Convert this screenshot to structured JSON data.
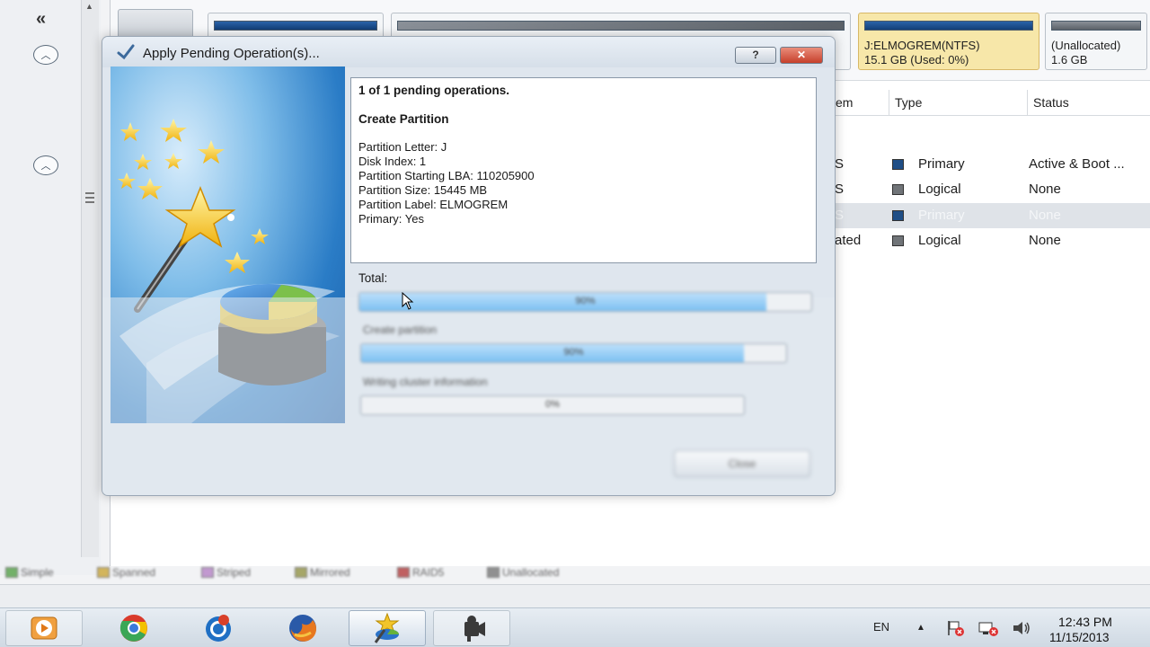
{
  "disk_map": {
    "partitions": [
      {
        "label": "",
        "detail": "",
        "bar": "blue"
      },
      {
        "label": "",
        "detail": "",
        "bar": "grey"
      },
      {
        "label": "J:ELMOGREM(NTFS)",
        "detail": "15.1 GB (Used: 0%)",
        "bar": "blue",
        "selected": true
      },
      {
        "label": "(Unallocated)",
        "detail": "1.6 GB",
        "bar": "grey"
      }
    ]
  },
  "partition_table": {
    "headers": {
      "file_system": "em",
      "type": "Type",
      "status": "Status"
    },
    "rows": [
      {
        "fs": "S",
        "type": "Primary",
        "type_color": "#1f4e86",
        "status": "Active & Boot ...",
        "selected": false
      },
      {
        "fs": "S",
        "type": "Logical",
        "type_color": "#707478",
        "status": "None",
        "selected": false
      },
      {
        "fs": "S",
        "type": "Primary",
        "type_color": "#1f4e86",
        "status": "None",
        "selected": true
      },
      {
        "fs": "ated",
        "type": "Logical",
        "type_color": "#707478",
        "status": "None",
        "selected": false
      }
    ]
  },
  "legend": [
    "Simple",
    "Spanned",
    "Striped",
    "Mirrored",
    "RAID5",
    "Unallocated"
  ],
  "legend_colors": [
    "#4a9d3c",
    "#c9a12a",
    "#b27bc4",
    "#8d8d3a",
    "#b03030",
    "#707070"
  ],
  "dialog": {
    "title": "Apply Pending Operation(s)...",
    "help_label": "?",
    "close_label": "✕",
    "ops": {
      "count_line": "1 of 1 pending operations.",
      "operation": "Create Partition",
      "details": [
        "Partition Letter: J",
        "Disk Index: 1",
        "Partition Starting LBA: 110205900",
        "Partition Size: 15445 MB",
        "Partition Label: ELMOGREM",
        "Primary: Yes"
      ]
    },
    "total_label": "Total:",
    "progress": [
      {
        "label": "",
        "percent": 0.9,
        "text": "90%"
      },
      {
        "label": "Create partition",
        "percent": 0.9,
        "text": "90%"
      },
      {
        "label": "Writing cluster information",
        "percent": 0.0,
        "text": "0%"
      }
    ],
    "close_button": "Close"
  },
  "taskbar": {
    "apps": [
      "media-player",
      "chrome",
      "ccleaner",
      "firefox",
      "partition-wizard",
      "camtasia"
    ],
    "active_app": "partition-wizard",
    "language": "EN",
    "time": "12:43 PM",
    "date": "11/15/2013"
  }
}
